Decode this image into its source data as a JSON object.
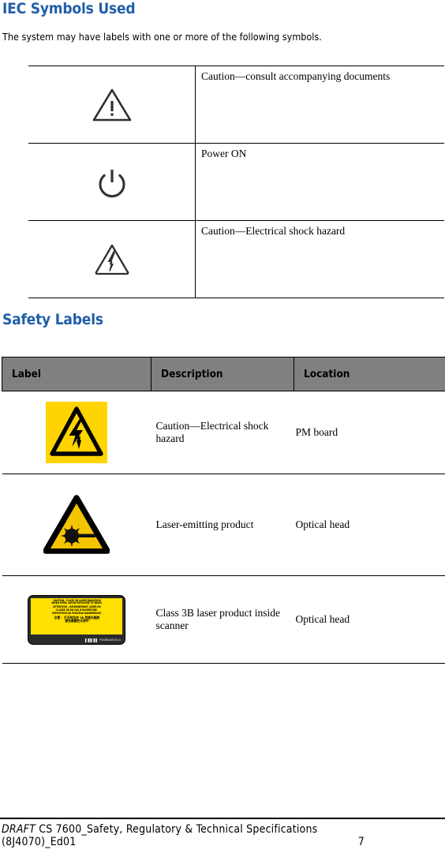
{
  "iec": {
    "title": "IEC Symbols Used",
    "intro": "The system may have labels with one or more of the following symbols.",
    "rows": [
      {
        "icon": "warning-triangle-exclamation-icon",
        "description": "Caution—consult accompanying documents"
      },
      {
        "icon": "power-on-icon",
        "description": "Power ON"
      },
      {
        "icon": "electrical-shock-triangle-icon",
        "description": "Caution—Electrical shock hazard"
      }
    ]
  },
  "safety": {
    "title": "Safety Labels",
    "columns": {
      "label": "Label",
      "description": "Description",
      "location": "Location"
    },
    "rows": [
      {
        "icon": "yellow-electrical-shock-label-icon",
        "description": "Caution—Electrical shock hazard",
        "location": "PM board"
      },
      {
        "icon": "yellow-laser-warning-triangle-icon",
        "description": "Laser-emitting product",
        "location": "Optical head"
      },
      {
        "icon": "class-3b-laser-warning-sticker-icon",
        "description": "Class 3B laser product inside scanner",
        "location": "Optical head",
        "sticker": {
          "en_line1": "CAUTION – CLASS 3B LASER RADIATION",
          "en_line2": "WHEN OPEN. AVOID EXPOSURE TO BEAM.",
          "fr_line1": "ATTENTION – RAYONNEMENT LASER DE",
          "fr_line2": "CLASSE 3B EN CAS D'OUVERTURE.",
          "fr_line3": "EXPOSITION  AU FAISCEAU DANGEREUSE.",
          "cn_line1": "注意： 打开时存在 3B 类激光辐射",
          "cn_line2": "避免暴露在光束中",
          "part_number": "P/N 8B4440192 A"
        }
      }
    ]
  },
  "footer": {
    "draft": "DRAFT",
    "document_title": "CS 7600_Safety, Regulatory & Technical Specifications",
    "document_code": "(8J4070)_Ed01",
    "page_number": "7"
  },
  "colors": {
    "heading_blue": "#1F5FA9",
    "header_gray": "#808080",
    "label_yellow": "#FFD400",
    "sticker_yellow": "#FFE000"
  }
}
